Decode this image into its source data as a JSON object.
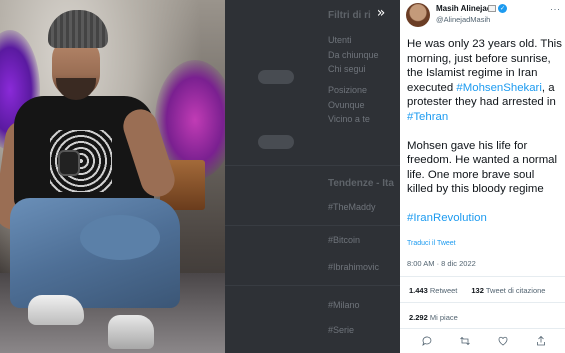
{
  "background_panel": {
    "headings": [
      "Filtri di ri",
      "Tendenze - Ita"
    ],
    "items": [
      "Utenti",
      "Da chiunque",
      "Chi segui",
      "Posizione",
      "Ovunque",
      "Vicino a te",
      "Segui",
      "Segui",
      "#TheMaddy",
      "#Bitcoin",
      "#Ibrahimovic",
      "#Milano",
      "#Serie"
    ],
    "buttons": [
      "Segui",
      "Segui"
    ]
  },
  "expand_icon": "»",
  "tweet": {
    "author_name": "Masih Alinejad",
    "author_handle": "@AlinejadMasih",
    "more_label": "···",
    "paragraph1_part1": "He was only 23 years old. This morning, just before sunrise, the Islamist regime in Iran executed ",
    "hashtag1": "#MohsenShekari",
    "paragraph1_part2": ", a protester they had arrested in ",
    "hashtag2": "#Tehran",
    "paragraph2": "Mohsen gave his life for freedom. He wanted a normal life. One more brave soul killed by this bloody regime",
    "hashtag3": "#IranRevolution",
    "translate_label": "Traduci il Tweet",
    "timestamp": "8:00 AM · 8 dic 2022",
    "retweets_count": "1.443",
    "retweets_label": "Retweet",
    "quotes_count": "132",
    "quotes_label": "Tweet di citazione",
    "likes_count": "2.292",
    "likes_label": "Mi piace"
  },
  "colors": {
    "link": "#1d9bf0",
    "text": "#0f1419",
    "secondary": "#536471"
  }
}
